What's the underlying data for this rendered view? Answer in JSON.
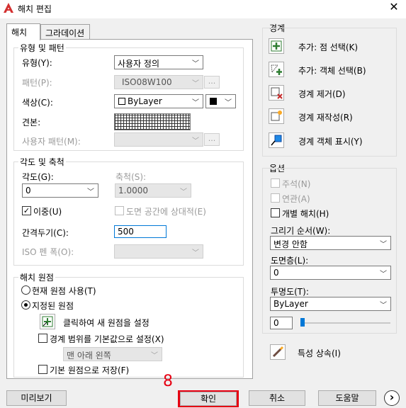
{
  "window": {
    "title": "해치 편집",
    "close_glyph": "✕"
  },
  "tabs": [
    {
      "label": "해치"
    },
    {
      "label": "그라데이션"
    }
  ],
  "type_pattern": {
    "group_title": "유형 및 패턴",
    "type_label": "유형(Y):",
    "type_value": "사용자 정의",
    "pattern_label": "패턴(P):",
    "pattern_value": "ISO08W100",
    "color_label": "색상(C):",
    "color_value": "ByLayer",
    "swatch_label": "견본:",
    "custom_pattern_label": "사용자 패턴(M):",
    "dots": "..."
  },
  "angle_scale": {
    "group_title": "각도 및 축척",
    "angle_label": "각도(G):",
    "angle_value": "0",
    "scale_label": "축척(S):",
    "scale_value": "1.0000",
    "double_label": "이중(U)",
    "double_checked": true,
    "paper_space_label": "도면 공간에 상대적(E)",
    "spacing_label": "간격두기(C):",
    "spacing_value": "500",
    "iso_pen_label": "ISO 펜 폭(O):"
  },
  "origin": {
    "group_title": "해치 원점",
    "use_current_label": "현재 원점 사용(T)",
    "specified_label": "지정된 원점",
    "click_set_label": "클릭하여 새 원점을 설정",
    "default_extent_label": "경계 범위를 기본값으로 설정(X)",
    "position_value": "맨 아래 왼쪽",
    "store_default_label": "기본 원점으로 저장(F)"
  },
  "boundaries": {
    "group_title": "경계",
    "add_pick_label": "추가: 점 선택(K)",
    "add_select_label": "추가: 객체 선택(B)",
    "remove_label": "경계 제거(D)",
    "recreate_label": "경계 재작성(R)",
    "view_label": "경계 객체 표시(Y)"
  },
  "options": {
    "group_title": "옵션",
    "annotative_label": "주석(N)",
    "associative_label": "연관(A)",
    "separate_label": "개별 해치(H)",
    "draw_order_label": "그리기 순서(W):",
    "draw_order_value": "변경 안함",
    "layer_label": "도면층(L):",
    "layer_value": "0",
    "transparency_label": "투명도(T):",
    "transparency_value": "ByLayer",
    "transparency_number": "0",
    "inherit_label": "특성 상속(I)"
  },
  "footer": {
    "preview_label": "미리보기",
    "ok_label": "확인",
    "cancel_label": "취소",
    "help_label": "도움말",
    "more_glyph": "›",
    "annotation_number": "8"
  },
  "colors": {
    "highlight": "#e60012",
    "accent": "#0078d7"
  }
}
